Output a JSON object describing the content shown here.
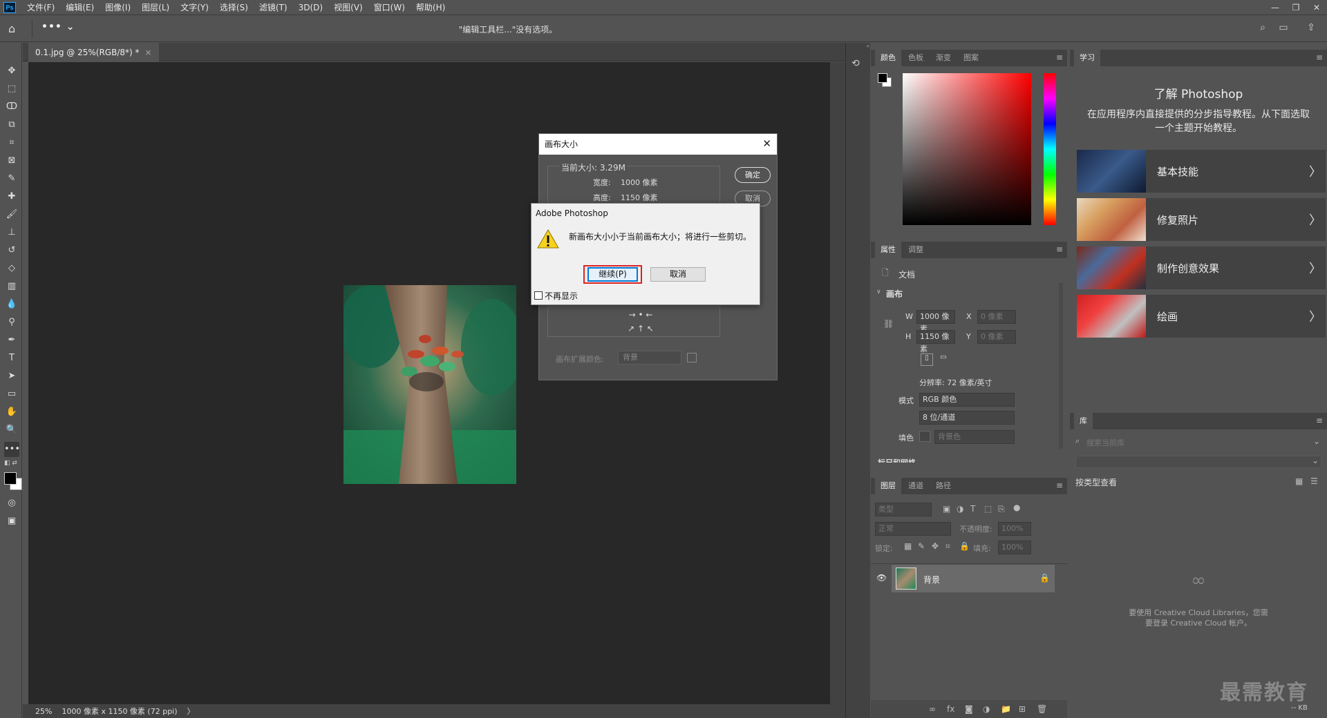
{
  "app": {
    "logo": "Ps",
    "menu": [
      "文件(F)",
      "编辑(E)",
      "图像(I)",
      "图层(L)",
      "文字(Y)",
      "选择(S)",
      "滤镜(T)",
      "3D(D)",
      "视图(V)",
      "窗口(W)",
      "帮助(H)"
    ]
  },
  "options_bar": {
    "message": "\"编辑工具栏...\"没有选项。"
  },
  "document": {
    "tab_title": "0.1.jpg @ 25%(RGB/8*) *",
    "close": "×"
  },
  "status_bar": {
    "zoom": "25%",
    "doc_info": "1000 像素 x 1150 像素 (72 ppi)",
    "arrow": "〉"
  },
  "canvas_size_dialog": {
    "title": "画布大小",
    "current_size": "当前大小: 3.29M",
    "width_label": "宽度:",
    "width_value": "1000 像素",
    "height_label": "高度:",
    "height_value": "1150 像素",
    "ok": "确定",
    "cancel": "取消",
    "extension_color_label": "画布扩展颜色:",
    "extension_color_value": "背景"
  },
  "alert_dialog": {
    "title": "Adobe Photoshop",
    "message": "新画布大小小于当前画布大小；将进行一些剪切。",
    "continue": "继续(P)",
    "cancel": "取消",
    "dont_show": "不再显示"
  },
  "color_panel": {
    "tabs": [
      "颜色",
      "色板",
      "渐变",
      "图案"
    ]
  },
  "properties_panel": {
    "tabs": [
      "属性",
      "调整"
    ],
    "doc_label": "文档",
    "section": "画布",
    "w_label": "W",
    "w_value": "1000 像素",
    "x_label": "X",
    "x_value": "0 像素",
    "h_label": "H",
    "h_value": "1150 像素",
    "y_label": "Y",
    "y_value": "0 像素",
    "resolution": "分辨率: 72 像素/英寸",
    "mode_label": "模式",
    "mode_value": "RGB 颜色",
    "depth_value": "8 位/通道",
    "fill_label": "填色",
    "fill_value": "背景色",
    "next_section": "标尺和网格"
  },
  "layers_panel": {
    "tabs": [
      "图层",
      "通道",
      "路径"
    ],
    "filter_placeholder": "类型",
    "blend_mode": "正常",
    "opacity_label": "不透明度:",
    "opacity_value": "100%",
    "lock_label": "锁定:",
    "fill_label": "填充:",
    "fill_value": "100%",
    "layer_name": "背景"
  },
  "learn_panel": {
    "tab": "学习",
    "title": "了解 Photoshop",
    "subtitle": "在应用程序内直接提供的分步指导教程。从下面选取一个主题开始教程。",
    "cards": [
      "基本技能",
      "修复照片",
      "制作创意效果",
      "绘画"
    ]
  },
  "library_panel": {
    "tab": "库",
    "search_placeholder": "搜索当前库",
    "view_by": "按类型查看",
    "signin_message": "要使用 Creative Cloud Libraries，您需要登录 Creative Cloud 帐户。",
    "size": "-- KB"
  },
  "watermark": "最需教育",
  "colors": {
    "highlight_red": "#e02020",
    "focus_blue": "#0078d7"
  }
}
